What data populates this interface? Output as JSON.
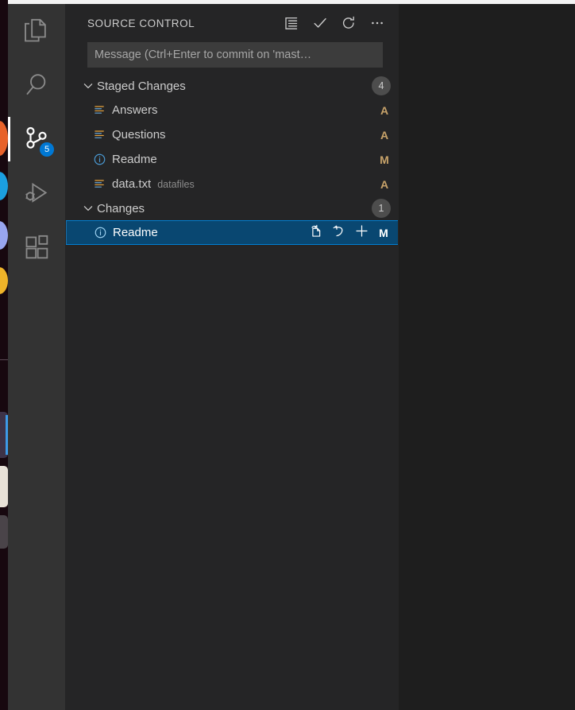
{
  "colors": {
    "activitybar_bg": "#333333",
    "sidebar_bg": "#252526",
    "editor_bg": "#1e1e1e",
    "selection_bg": "#094771",
    "selection_border": "#007fd4",
    "badge_bg": "#0078d4",
    "count_badge_bg": "#4d4d4d",
    "status_letter": "#c8a36a",
    "foreground": "#cccccc"
  },
  "activitybar": {
    "items": [
      {
        "name": "explorer",
        "icon": "files-icon",
        "active": false,
        "badge": null
      },
      {
        "name": "search",
        "icon": "search-icon",
        "active": false,
        "badge": null
      },
      {
        "name": "source-control",
        "icon": "source-control-icon",
        "active": true,
        "badge": "5"
      },
      {
        "name": "run-and-debug",
        "icon": "debug-icon",
        "active": false,
        "badge": null
      },
      {
        "name": "extensions",
        "icon": "extensions-icon",
        "active": false,
        "badge": null
      }
    ]
  },
  "panel": {
    "title": "SOURCE CONTROL",
    "actions": [
      {
        "name": "view-as-tree-button",
        "icon": "list-flat-icon",
        "tooltip": "View as Tree"
      },
      {
        "name": "commit-button",
        "icon": "check-icon",
        "tooltip": "Commit"
      },
      {
        "name": "refresh-button",
        "icon": "refresh-icon",
        "tooltip": "Refresh"
      },
      {
        "name": "more-actions-button",
        "icon": "ellipsis-icon",
        "tooltip": "More Actions..."
      }
    ]
  },
  "commit": {
    "value": "",
    "placeholder": "Message (Ctrl+Enter to commit on 'mast…"
  },
  "groups": [
    {
      "name": "staged-changes",
      "label": "Staged Changes",
      "count": "4",
      "expanded": true,
      "twisty": "chevron-down-icon",
      "resources": [
        {
          "name": "Answers",
          "description": "",
          "icon": "text-file-icon",
          "status": "A",
          "selected": false,
          "actions": []
        },
        {
          "name": "Questions",
          "description": "",
          "icon": "text-file-icon",
          "status": "A",
          "selected": false,
          "actions": []
        },
        {
          "name": "Readme",
          "description": "",
          "icon": "info-file-icon",
          "status": "M",
          "selected": false,
          "actions": []
        },
        {
          "name": "data.txt",
          "description": "datafiles",
          "icon": "text-file-icon",
          "status": "A",
          "selected": false,
          "actions": []
        }
      ]
    },
    {
      "name": "changes",
      "label": "Changes",
      "count": "1",
      "expanded": true,
      "twisty": "chevron-down-icon",
      "resources": [
        {
          "name": "Readme",
          "description": "",
          "icon": "info-file-icon",
          "status": "M",
          "selected": true,
          "actions": [
            {
              "name": "open-file-button",
              "icon": "open-file-icon",
              "tooltip": "Open File"
            },
            {
              "name": "discard-changes-button",
              "icon": "discard-icon",
              "tooltip": "Discard Changes"
            },
            {
              "name": "stage-changes-button",
              "icon": "plus-icon",
              "tooltip": "Stage Changes"
            }
          ]
        }
      ]
    }
  ]
}
